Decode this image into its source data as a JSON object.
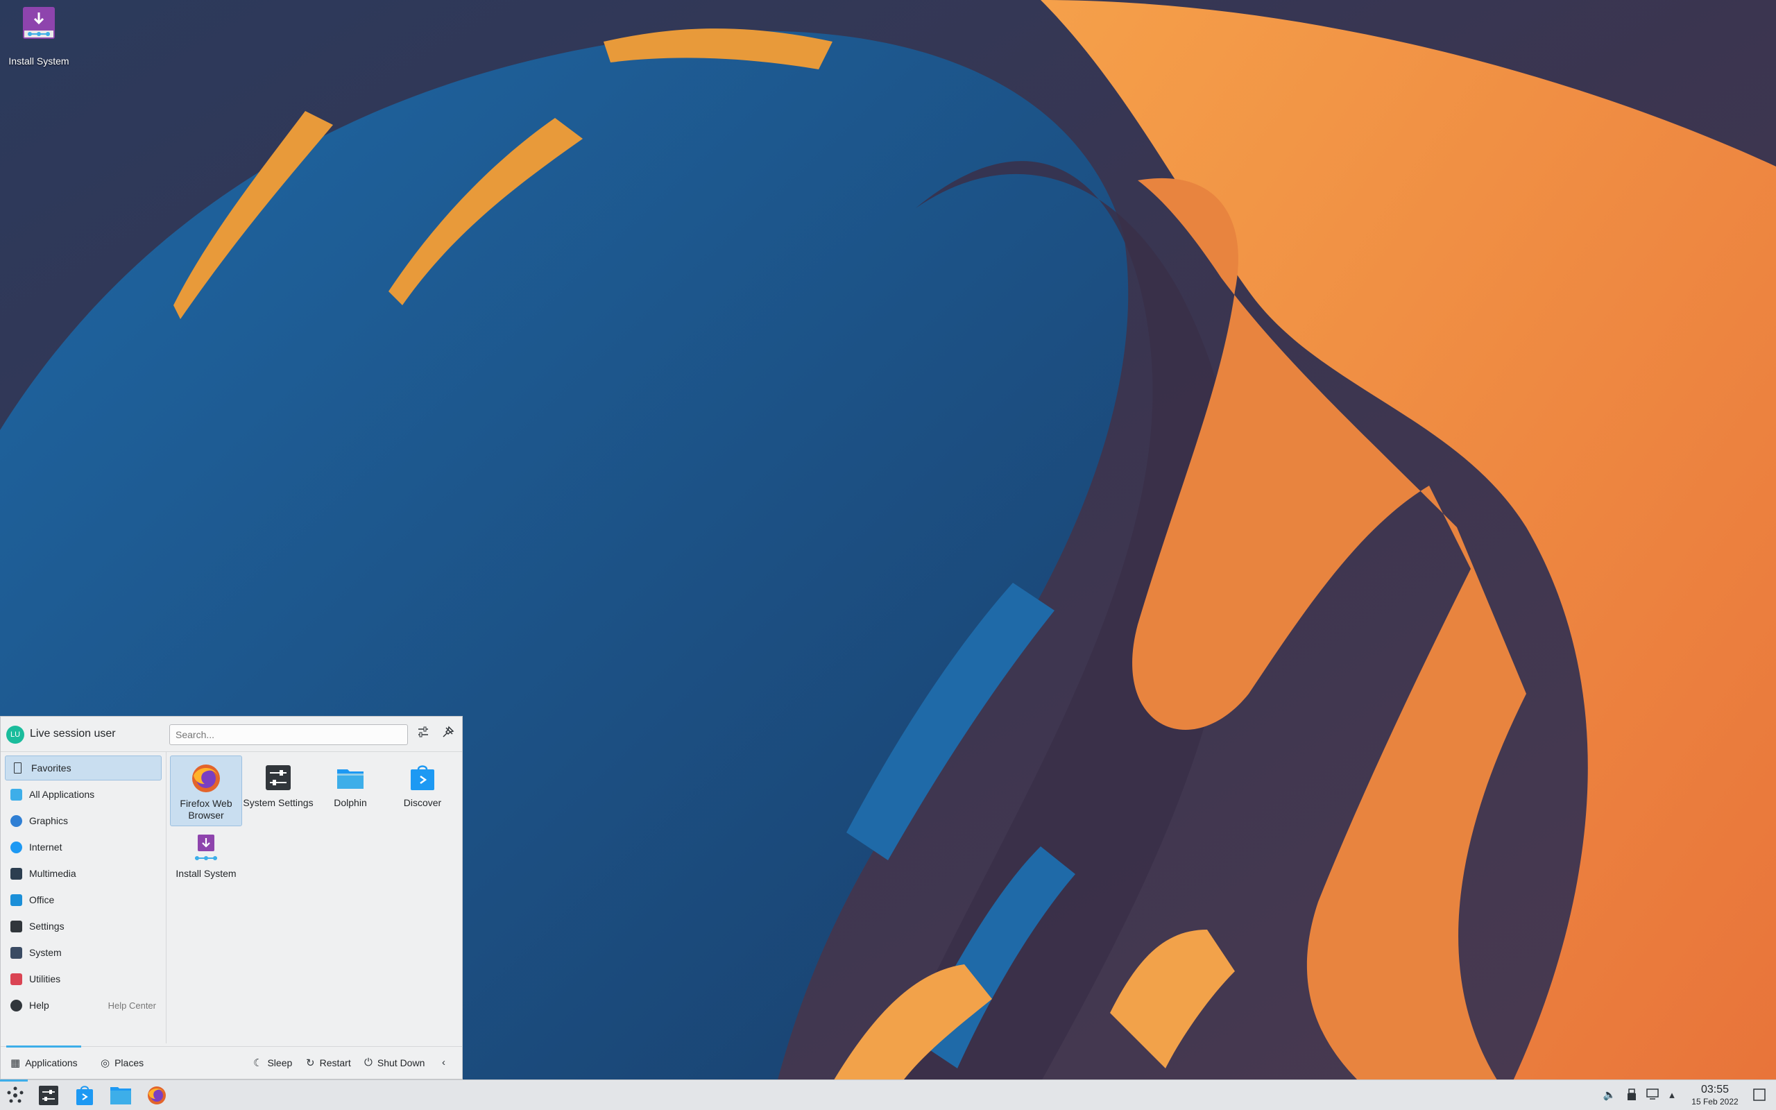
{
  "desktop": {
    "icons": [
      {
        "label": "Install System",
        "icon": "install-system-icon"
      }
    ]
  },
  "launcher": {
    "user": {
      "name": "Live session user",
      "initials": "LU"
    },
    "search": {
      "placeholder": "Search..."
    },
    "header_buttons": [
      {
        "icon": "configure-icon"
      },
      {
        "icon": "pin-icon"
      }
    ],
    "categories": [
      {
        "label": "Favorites",
        "icon": "bookmark-icon",
        "active": true
      },
      {
        "label": "All Applications",
        "icon": "grid-icon"
      },
      {
        "label": "Graphics",
        "icon": "graphics-icon"
      },
      {
        "label": "Internet",
        "icon": "globe-icon"
      },
      {
        "label": "Multimedia",
        "icon": "multimedia-icon"
      },
      {
        "label": "Office",
        "icon": "office-icon"
      },
      {
        "label": "Settings",
        "icon": "settings-icon"
      },
      {
        "label": "System",
        "icon": "system-icon"
      },
      {
        "label": "Utilities",
        "icon": "utilities-icon"
      },
      {
        "label": "Help",
        "icon": "help-icon",
        "hint": "Help Center"
      }
    ],
    "favorites": [
      {
        "label": "Firefox Web Browser",
        "icon": "firefox-icon",
        "active": true
      },
      {
        "label": "System Settings",
        "icon": "system-settings-icon"
      },
      {
        "label": "Dolphin",
        "icon": "folder-icon"
      },
      {
        "label": "Discover",
        "icon": "discover-icon"
      },
      {
        "label": "Install System",
        "icon": "install-system-icon"
      }
    ],
    "footer": {
      "tabs": [
        {
          "label": "Applications",
          "icon": "grid-icon",
          "active": true
        },
        {
          "label": "Places",
          "icon": "compass-icon"
        }
      ],
      "power": [
        {
          "label": "Sleep",
          "icon": "sleep-icon"
        },
        {
          "label": "Restart",
          "icon": "restart-icon"
        },
        {
          "label": "Shut Down",
          "icon": "power-icon"
        }
      ],
      "more_icon": "chevron-left-icon"
    }
  },
  "taskbar": {
    "items": [
      {
        "name": "application-launcher",
        "icon": "kde-launcher-icon",
        "active": true
      },
      {
        "name": "system-settings",
        "icon": "system-settings-icon"
      },
      {
        "name": "discover",
        "icon": "discover-icon"
      },
      {
        "name": "dolphin",
        "icon": "folder-icon"
      },
      {
        "name": "firefox",
        "icon": "firefox-icon"
      }
    ],
    "tray": [
      "volume-icon",
      "usb-icon",
      "display-icon",
      "expand-arrow-icon"
    ],
    "clock": {
      "time": "03:55",
      "date": "15 Feb 2022"
    },
    "show_desktop_icon": "show-desktop-icon"
  },
  "colors": {
    "accent": "#3daee9",
    "panel_bg": "#eff0f1",
    "selection": "#c9def0",
    "wallpaper_blue": "#1a5c94",
    "wallpaper_orange": "#f08a3c"
  }
}
